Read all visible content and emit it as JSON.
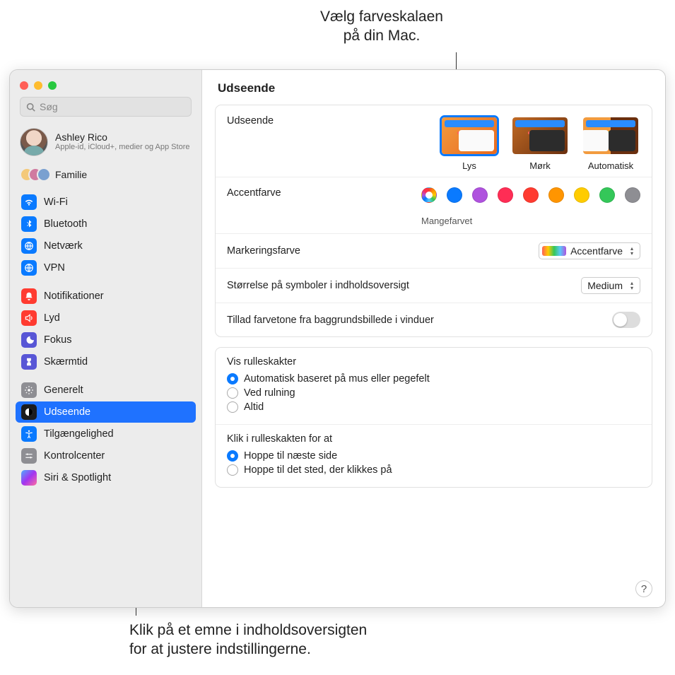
{
  "callouts": {
    "top": "Vælg farveskalaen\npå din Mac.",
    "bottom": "Klik på et emne i indholdsoversigten\nfor at justere indstillingerne."
  },
  "search_placeholder": "Søg",
  "profile": {
    "name": "Ashley Rico",
    "sub": "Apple-id, iCloud+, medier og App Store"
  },
  "family_label": "Familie",
  "sidebar_groups": [
    {
      "items": [
        {
          "id": "wifi",
          "label": "Wi-Fi",
          "color": "#0a7aff"
        },
        {
          "id": "bluetooth",
          "label": "Bluetooth",
          "color": "#0a7aff"
        },
        {
          "id": "network",
          "label": "Netværk",
          "color": "#0a7aff"
        },
        {
          "id": "vpn",
          "label": "VPN",
          "color": "#0a7aff"
        }
      ]
    },
    {
      "items": [
        {
          "id": "notifications",
          "label": "Notifikationer",
          "color": "#ff3b30"
        },
        {
          "id": "sound",
          "label": "Lyd",
          "color": "#ff3b30"
        },
        {
          "id": "focus",
          "label": "Fokus",
          "color": "#5856d6"
        },
        {
          "id": "screentime",
          "label": "Skærmtid",
          "color": "#5856d6"
        }
      ]
    },
    {
      "items": [
        {
          "id": "general",
          "label": "Generelt",
          "color": "#8e8e93"
        },
        {
          "id": "appearance",
          "label": "Udseende",
          "color": "#1c1c1e",
          "selected": true
        },
        {
          "id": "accessibility",
          "label": "Tilgængelighed",
          "color": "#0a7aff"
        },
        {
          "id": "controlcenter",
          "label": "Kontrolcenter",
          "color": "#8e8e93"
        },
        {
          "id": "siri",
          "label": "Siri & Spotlight",
          "color": "#000",
          "gradient": true
        }
      ]
    }
  ],
  "header_title": "Udseende",
  "appearance": {
    "label": "Udseende",
    "options": [
      {
        "id": "light",
        "label": "Lys",
        "selected": true
      },
      {
        "id": "dark",
        "label": "Mørk"
      },
      {
        "id": "auto",
        "label": "Automatisk"
      }
    ]
  },
  "accent": {
    "label": "Accentfarve",
    "selected_label": "Mangefarvet",
    "colors": [
      "multi",
      "#0a7aff",
      "#af52de",
      "#ff2d55",
      "#ff3b30",
      "#ff9500",
      "#ffcc00",
      "#34c759",
      "#8e8e93"
    ]
  },
  "highlight": {
    "label": "Markeringsfarve",
    "value": "Accentfarve"
  },
  "sidebar_icon_size": {
    "label": "Størrelse på symboler i indholdsoversigt",
    "value": "Medium"
  },
  "wallpaper_tint": {
    "label": "Tillad farvetone fra baggrundsbillede i vinduer",
    "on": false
  },
  "scrollbars": {
    "title": "Vis rulleskakter",
    "options": [
      {
        "label": "Automatisk baseret på mus eller pegefelt",
        "checked": true
      },
      {
        "label": "Ved rulning"
      },
      {
        "label": "Altid"
      }
    ]
  },
  "scroll_click": {
    "title": "Klik i rulleskakten for at",
    "options": [
      {
        "label": "Hoppe til næste side",
        "checked": true
      },
      {
        "label": "Hoppe til det sted, der klikkes på"
      }
    ]
  },
  "help_tooltip": "?"
}
